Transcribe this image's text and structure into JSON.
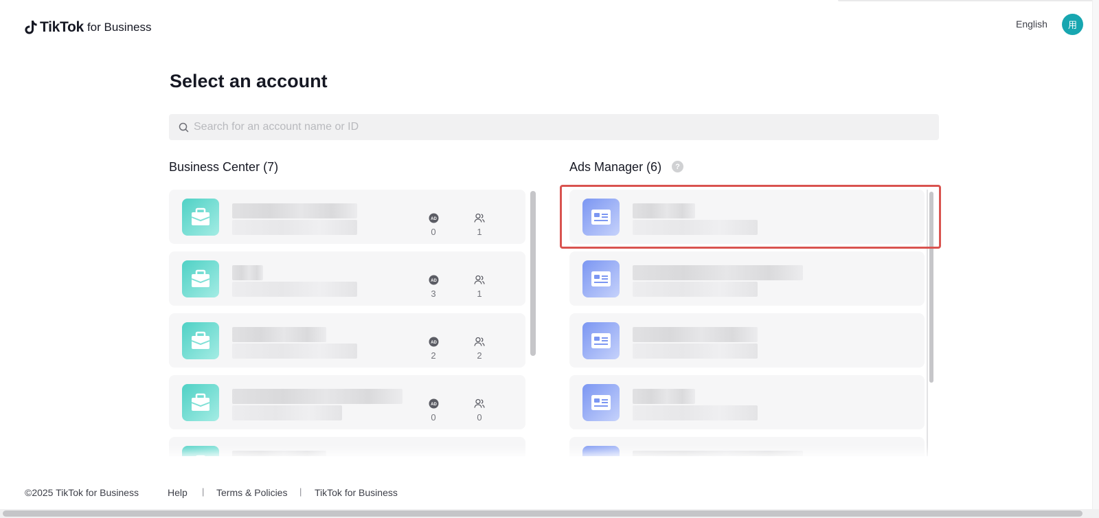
{
  "header": {
    "logo_text": "TikTok",
    "logo_sub": "for Business",
    "language": "English",
    "avatar_text": "用"
  },
  "page_title": "Select an account",
  "search": {
    "placeholder": "Search for an account name or ID"
  },
  "business_center": {
    "title": "Business Center (7)",
    "items": [
      {
        "ad_count": "0",
        "member_count": "1"
      },
      {
        "ad_count": "3",
        "member_count": "1"
      },
      {
        "ad_count": "2",
        "member_count": "2"
      },
      {
        "ad_count": "0",
        "member_count": "0"
      },
      {
        "ad_count": "",
        "member_count": ""
      }
    ]
  },
  "ads_manager": {
    "title": "Ads Manager (6)",
    "help": "?",
    "item_count_visible": 5
  },
  "footer": {
    "copyright": "©2025 TikTok for Business",
    "links": [
      "Help",
      "Terms & Policies",
      "TikTok for Business"
    ],
    "separator": "|"
  },
  "colors": {
    "highlight": "#d9534f",
    "avatar": "#17a6b0",
    "business_icon": "#4fd1c5",
    "ads_icon": "#7b96f2"
  },
  "icons": {
    "business_center_item": "briefcase-icon",
    "ads_manager_item": "id-card-icon",
    "ad_stat": "ad-badge-icon",
    "member_stat": "users-icon"
  }
}
